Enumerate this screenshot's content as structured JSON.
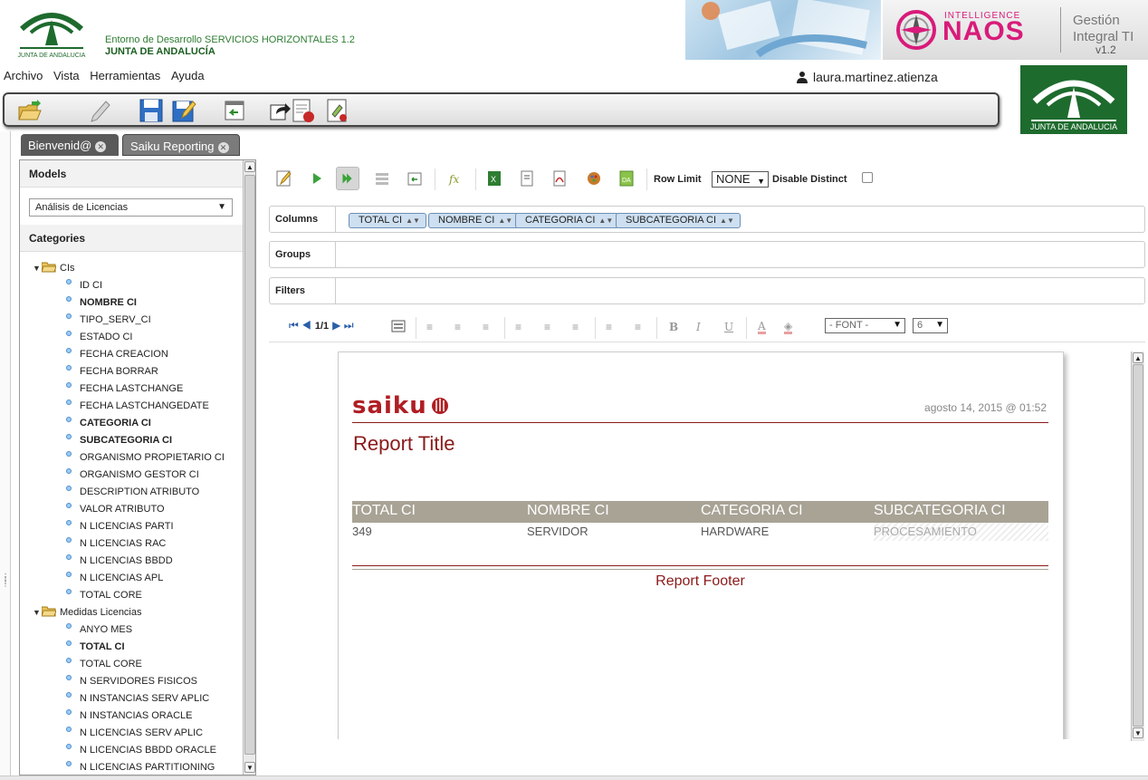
{
  "header": {
    "env_line1": "Entorno de Desarrollo SERVICIOS HORIZONTALES 1.2",
    "env_line2": "JUNTA DE ANDALUCÍA",
    "logo_caption": "JUNTA DE ANDALUCIA",
    "naos_small": "INTELLIGENCE",
    "naos_big": "NAOS",
    "naos_gestion_1": "Gestión",
    "naos_gestion_2": "Integral TI",
    "naos_version": "v1.2"
  },
  "menu": [
    "Archivo",
    "Vista",
    "Herramientas",
    "Ayuda"
  ],
  "user": {
    "name": "laura.martinez.atienza"
  },
  "tabs": [
    {
      "label": "Bienvenid@"
    },
    {
      "label": "Saiku Reporting"
    }
  ],
  "left": {
    "models_title": "Models",
    "models_selected": "Análisis de Licencias",
    "categories_title": "Categories",
    "tree": [
      {
        "type": "folder",
        "label": "CIs"
      },
      {
        "type": "leaf",
        "label": "ID CI",
        "bold": false
      },
      {
        "type": "leaf",
        "label": "NOMBRE CI",
        "bold": true
      },
      {
        "type": "leaf",
        "label": "TIPO_SERV_CI",
        "bold": false
      },
      {
        "type": "leaf",
        "label": "ESTADO CI",
        "bold": false
      },
      {
        "type": "leaf",
        "label": "FECHA CREACION",
        "bold": false
      },
      {
        "type": "leaf",
        "label": "FECHA BORRAR",
        "bold": false
      },
      {
        "type": "leaf",
        "label": "FECHA LASTCHANGE",
        "bold": false
      },
      {
        "type": "leaf",
        "label": "FECHA LASTCHANGEDATE",
        "bold": false
      },
      {
        "type": "leaf",
        "label": "CATEGORIA CI",
        "bold": true
      },
      {
        "type": "leaf",
        "label": "SUBCATEGORIA CI",
        "bold": true
      },
      {
        "type": "leaf",
        "label": "ORGANISMO PROPIETARIO CI",
        "bold": false
      },
      {
        "type": "leaf",
        "label": "ORGANISMO GESTOR CI",
        "bold": false
      },
      {
        "type": "leaf",
        "label": "DESCRIPTION ATRIBUTO",
        "bold": false
      },
      {
        "type": "leaf",
        "label": "VALOR ATRIBUTO",
        "bold": false
      },
      {
        "type": "leaf",
        "label": "N LICENCIAS PARTI",
        "bold": false
      },
      {
        "type": "leaf",
        "label": "N LICENCIAS RAC",
        "bold": false
      },
      {
        "type": "leaf",
        "label": "N LICENCIAS BBDD",
        "bold": false
      },
      {
        "type": "leaf",
        "label": "N LICENCIAS APL",
        "bold": false
      },
      {
        "type": "leaf",
        "label": "TOTAL CORE",
        "bold": false
      },
      {
        "type": "folder",
        "label": "Medidas Licencias"
      },
      {
        "type": "leaf",
        "label": "ANYO MES",
        "bold": false
      },
      {
        "type": "leaf",
        "label": "TOTAL CI",
        "bold": true
      },
      {
        "type": "leaf",
        "label": "TOTAL CORE",
        "bold": false
      },
      {
        "type": "leaf",
        "label": "N SERVIDORES FISICOS",
        "bold": false
      },
      {
        "type": "leaf",
        "label": "N INSTANCIAS SERV APLIC",
        "bold": false
      },
      {
        "type": "leaf",
        "label": "N INSTANCIAS ORACLE",
        "bold": false
      },
      {
        "type": "leaf",
        "label": "N LICENCIAS SERV APLIC",
        "bold": false
      },
      {
        "type": "leaf",
        "label": "N LICENCIAS BBDD ORACLE",
        "bold": false
      },
      {
        "type": "leaf",
        "label": "N LICENCIAS PARTITIONING",
        "bold": false
      }
    ]
  },
  "workspace": {
    "row_limit_label": "Row Limit",
    "row_limit_value": "NONE",
    "disable_distinct_label": "Disable Distinct",
    "columns_label": "Columns",
    "groups_label": "Groups",
    "filters_label": "Filters",
    "columns": [
      "TOTAL CI",
      "NOMBRE CI",
      "CATEGORIA CI",
      "SUBCATEGORIA CI"
    ],
    "pager": "1/1",
    "font_select": "- FONT -",
    "size_select": "6"
  },
  "report": {
    "logo": "saiku",
    "date": "agosto 14, 2015 @ 01:52",
    "title": "Report Title",
    "headers": [
      "TOTAL CI",
      "NOMBRE CI",
      "CATEGORIA CI",
      "SUBCATEGORIA CI"
    ],
    "row": [
      "349",
      "SERVIDOR",
      "HARDWARE",
      "PROCESAMIENTO"
    ],
    "footer": "Report Footer"
  },
  "colors": {
    "accent_red": "#8b1a1a",
    "table_header": "#a8a395",
    "pill_bg": "#cddff0",
    "ja_green": "#1e6b2e"
  }
}
